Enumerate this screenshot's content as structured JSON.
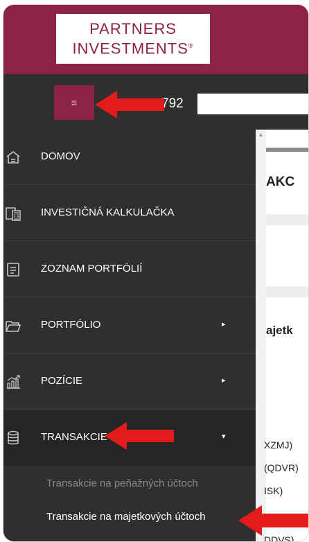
{
  "brand": {
    "line1": "PARTNERS",
    "line2": "INVESTMENTS",
    "reg_mark": "®"
  },
  "header": {
    "menu_icon": "≡",
    "user_id": "792"
  },
  "sidebar": {
    "items": [
      {
        "label": "DOMOV",
        "icon": "home-icon"
      },
      {
        "label": "INVESTIČNÁ KALKULAČKA",
        "icon": "calculator-icon"
      },
      {
        "label": "ZOZNAM PORTFÓLIÍ",
        "icon": "document-icon"
      },
      {
        "label": "PORTFÓLIO",
        "icon": "folder-icon",
        "caret": "▸"
      },
      {
        "label": "POZÍCIE",
        "icon": "chart-icon",
        "caret": "▸"
      },
      {
        "label": "TRANSAKCIE",
        "icon": "database-icon",
        "caret": "▾"
      }
    ],
    "subitems": [
      {
        "label": "Transakcie na peňažných účtoch"
      },
      {
        "label": "Transakcie na majetkových účtoch"
      }
    ]
  },
  "content": {
    "title_fragment": "AKC",
    "section_fragment": "ajetk",
    "codes": [
      "XZMJ)",
      "(QDVR)",
      "ISK)",
      "DDVS)"
    ]
  },
  "colors": {
    "brand": "#8e2246",
    "sidebar_bg": "#2f2f2f",
    "arrow": "#e41b1b"
  }
}
